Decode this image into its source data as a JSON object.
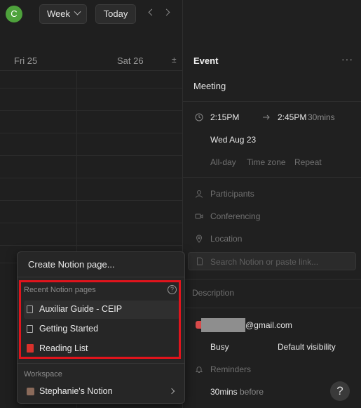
{
  "topbar": {
    "avatar_letter": "C",
    "view_label": "Week",
    "today_label": "Today"
  },
  "calendar": {
    "days": [
      "Fri 25",
      "Sat 26"
    ],
    "expand_glyph": "±"
  },
  "event": {
    "panel_title": "Event",
    "more_glyph": "···",
    "name": "Meeting",
    "start_time": "2:15PM",
    "end_time": "2:45PM",
    "duration": "30mins",
    "date": "Wed Aug 23",
    "options": [
      "All-day",
      "Time zone",
      "Repeat"
    ],
    "participants_label": "Participants",
    "conferencing_label": "Conferencing",
    "location_label": "Location",
    "search_placeholder": "Search Notion or paste link...",
    "description_label": "Description",
    "email_suffix": "@gmail.com",
    "busy_label": "Busy",
    "visibility_label": "Default visibility",
    "reminders_label": "Reminders",
    "reminder_value": "30mins",
    "reminder_suffix": "before",
    "help_glyph": "?"
  },
  "popup": {
    "create_label": "Create Notion page...",
    "recent_header": "Recent Notion pages",
    "info_glyph": "?",
    "recent_pages": [
      {
        "label": "Auxiliar Guide - CEIP",
        "icon": "page-icon"
      },
      {
        "label": "Getting Started",
        "icon": "page-icon"
      },
      {
        "label": "Reading List",
        "icon": "book-icon"
      }
    ],
    "workspace_header": "Workspace",
    "workspace_name": "Stephanie's Notion"
  },
  "colors": {
    "accent_avatar": "#4ea23c",
    "highlight": "#e0141c",
    "background": "#1f1f1f"
  }
}
